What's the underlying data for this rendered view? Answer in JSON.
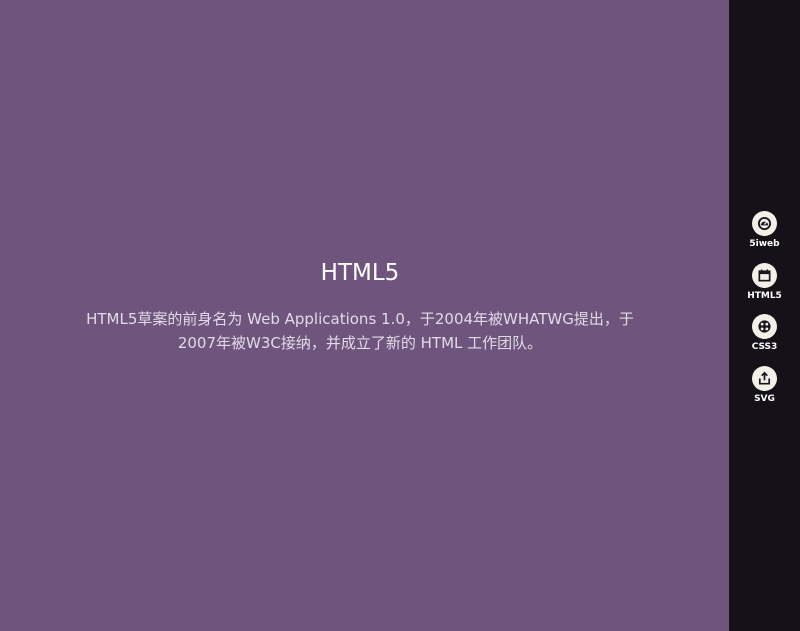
{
  "section": {
    "title": "HTML5",
    "text": "HTML5草案的前身名为 Web Applications 1.0，于2004年被WHATWG提出，于2007年被W3C接纳，并成立了新的 HTML 工作团队。"
  },
  "nav": {
    "items": [
      {
        "label": "5iweb",
        "icon": "dashboard-icon",
        "active": false
      },
      {
        "label": "HTML5",
        "icon": "calendar-icon",
        "active": true
      },
      {
        "label": "CSS3",
        "icon": "dots-grid-icon",
        "active": false
      },
      {
        "label": "SVG",
        "icon": "share-icon",
        "active": false
      }
    ]
  },
  "colors": {
    "main_background": "#6f557d",
    "sidebar_background": "#141118",
    "nav_circle": "#f3f0e8",
    "nav_circle_active": "#c6a56f"
  }
}
